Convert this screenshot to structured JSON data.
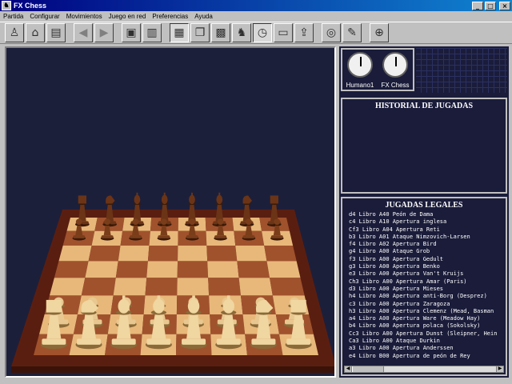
{
  "window": {
    "title": "FX Chess",
    "minimize": "_",
    "maximize": "□",
    "close": "×"
  },
  "menu": [
    "Partida",
    "Configurar",
    "Movimientos",
    "Juego en red",
    "Preferencias",
    "Ayuda"
  ],
  "toolbar": {
    "buttons": [
      {
        "icon": "pawn-icon",
        "glyph": "♙"
      },
      {
        "icon": "open-icon",
        "glyph": "📂"
      },
      {
        "icon": "save-icon",
        "glyph": "💾"
      },
      {
        "icon": "back-arrow-icon",
        "glyph": "◀"
      },
      {
        "icon": "forward-arrow-icon",
        "glyph": "▶"
      },
      {
        "icon": "cpu-icon",
        "glyph": "▣"
      },
      {
        "icon": "keyboard-icon",
        "glyph": "⌨"
      },
      {
        "icon": "board-icon",
        "glyph": "▦"
      },
      {
        "icon": "copy-icon",
        "glyph": "❐"
      },
      {
        "icon": "setup-board-icon",
        "glyph": "▩"
      },
      {
        "icon": "knight-icon",
        "glyph": "♞"
      },
      {
        "icon": "clock-icon",
        "glyph": "◷"
      },
      {
        "icon": "image-icon",
        "glyph": "▭"
      },
      {
        "icon": "export-icon",
        "glyph": "⇪"
      },
      {
        "icon": "network-icon",
        "glyph": "🌐"
      },
      {
        "icon": "tools-icon",
        "glyph": "✎"
      },
      {
        "icon": "help-globe-icon",
        "glyph": "⊕"
      }
    ]
  },
  "clocks": [
    {
      "label": "Humano1"
    },
    {
      "label": "FX Chess"
    }
  ],
  "historial": {
    "title": "HISTORIAL DE JUGADAS"
  },
  "legales": {
    "title": "JUGADAS LEGALES",
    "moves": [
      "d4 Libro A40 Peón de Dama",
      "c4 Libro A10 Apertura inglesa",
      "Cf3 Libro A04 Apertura Reti",
      "b3 Libro A01 Ataque Nimzovich-Larsen",
      "f4 Libro A02 Apertura Bird",
      "g4 Libro A00 Ataque Grob",
      "f3 Libro A00 Apertura Gedult",
      "g3 Libro A00 Apertura Benko",
      "e3 Libro A00 Apertura Van't Kruijs",
      "Ch3 Libro A00 Apertura Amar (Paris)",
      "d3 Libro A00 Apertura Mieses",
      "h4 Libro A00 Apertura anti-Borg (Desprez)",
      "c3 Libro A00 Apertura Zaragoza",
      "h3 Libro A00 Apertura Clemenz (Mead, Basman",
      "a4 Libro A00 Apertura Ware (Meadow Hay)",
      "b4 Libro A00 Apertura polaca (Sokolsky)",
      "Cc3 Libro A00 Apertura Dunst (Sleipner, Hein",
      "Ca3 Libro A00 Ataque Durkin",
      "a3 Libro A00 Apertura Anderssen",
      "e4 Libro B00 Apertura de peón de Rey"
    ]
  },
  "colors": {
    "panel_bg": "#1a1c3a",
    "board_bg": "#1c1f3a",
    "title_blue": "#000080",
    "light_square": "#e8b87a",
    "dark_square": "#a0522d"
  }
}
